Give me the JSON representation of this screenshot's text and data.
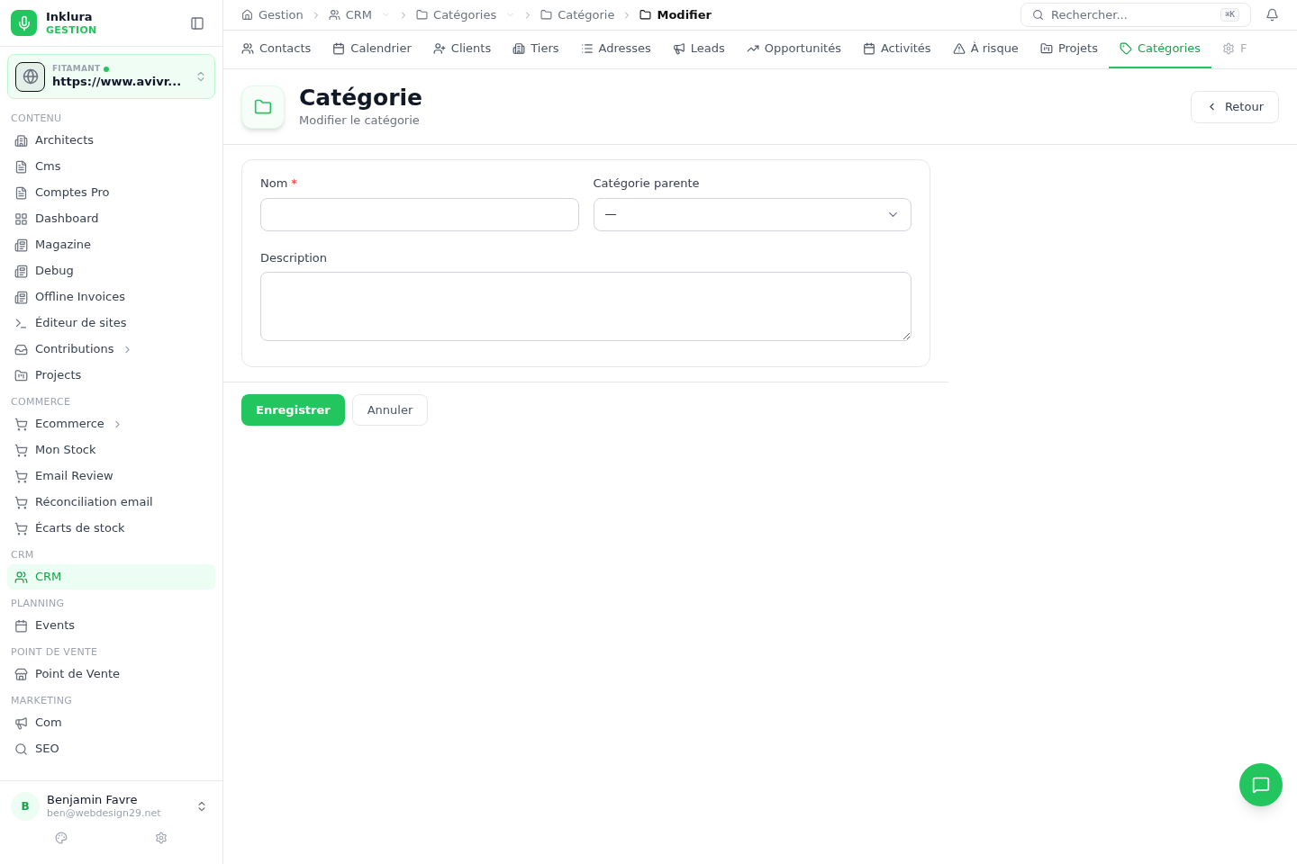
{
  "brand": {
    "name": "Inklura",
    "subtitle": "GESTION"
  },
  "workspace": {
    "label": "FITAMANT",
    "online": true,
    "url": "https://www.avivr..."
  },
  "sidebar": {
    "sections": [
      {
        "title": "CONTENU",
        "items": [
          {
            "label": "Architects",
            "selected": false,
            "has_children": false
          },
          {
            "label": "Cms",
            "selected": false,
            "has_children": false
          },
          {
            "label": "Comptes Pro",
            "selected": false,
            "has_children": false
          },
          {
            "label": "Dashboard",
            "selected": false,
            "has_children": false
          },
          {
            "label": "Magazine",
            "selected": false,
            "has_children": false
          },
          {
            "label": "Debug",
            "selected": false,
            "has_children": false
          },
          {
            "label": "Offline Invoices",
            "selected": false,
            "has_children": false
          },
          {
            "label": "Éditeur de sites",
            "selected": false,
            "has_children": false
          },
          {
            "label": "Contributions",
            "selected": false,
            "has_children": true
          },
          {
            "label": "Projects",
            "selected": false,
            "has_children": false
          }
        ]
      },
      {
        "title": "COMMERCE",
        "items": [
          {
            "label": "Ecommerce",
            "selected": false,
            "has_children": true
          },
          {
            "label": "Mon Stock",
            "selected": false,
            "has_children": false
          },
          {
            "label": "Email Review",
            "selected": false,
            "has_children": false
          },
          {
            "label": "Réconciliation email",
            "selected": false,
            "has_children": false
          },
          {
            "label": "Écarts de stock",
            "selected": false,
            "has_children": false
          }
        ]
      },
      {
        "title": "CRM",
        "items": [
          {
            "label": "CRM",
            "selected": true,
            "has_children": false
          }
        ]
      },
      {
        "title": "PLANNING",
        "items": [
          {
            "label": "Events",
            "selected": false,
            "has_children": false
          }
        ]
      },
      {
        "title": "POINT DE VENTE",
        "items": [
          {
            "label": "Point de Vente",
            "selected": false,
            "has_children": false
          }
        ]
      },
      {
        "title": "MARKETING",
        "items": [
          {
            "label": "Com",
            "selected": false,
            "has_children": false
          },
          {
            "label": "SEO",
            "selected": false,
            "has_children": false
          }
        ]
      }
    ]
  },
  "user": {
    "initial": "B",
    "name": "Benjamin Favre",
    "email": "ben@webdesign29.net"
  },
  "breadcrumbs": [
    {
      "label": "Gestion",
      "dropdown": false,
      "current": false
    },
    {
      "label": "CRM",
      "dropdown": true,
      "current": false
    },
    {
      "label": "Catégories",
      "dropdown": true,
      "current": false
    },
    {
      "label": "Catégorie",
      "dropdown": false,
      "current": false
    },
    {
      "label": "Modifier",
      "dropdown": false,
      "current": true
    }
  ],
  "search": {
    "placeholder": "Rechercher...",
    "shortcut": "⌘K"
  },
  "tabs": [
    {
      "label": "Contacts",
      "selected": false,
      "faded": false
    },
    {
      "label": "Calendrier",
      "selected": false,
      "faded": false
    },
    {
      "label": "Clients",
      "selected": false,
      "faded": false
    },
    {
      "label": "Tiers",
      "selected": false,
      "faded": false
    },
    {
      "label": "Adresses",
      "selected": false,
      "faded": false
    },
    {
      "label": "Leads",
      "selected": false,
      "faded": false
    },
    {
      "label": "Opportunités",
      "selected": false,
      "faded": false
    },
    {
      "label": "Activités",
      "selected": false,
      "faded": false
    },
    {
      "label": "À risque",
      "selected": false,
      "faded": false
    },
    {
      "label": "Projets",
      "selected": false,
      "faded": false
    },
    {
      "label": "Catégories",
      "selected": true,
      "faded": false
    },
    {
      "label": "F",
      "selected": false,
      "faded": true
    }
  ],
  "page": {
    "title": "Catégorie",
    "subtitle": "Modifier le catégorie",
    "back": "Retour"
  },
  "form": {
    "required_mark": "*",
    "fields": [
      {
        "kind": "text",
        "label": "Nom",
        "required": true
      },
      {
        "kind": "select",
        "label": "Catégorie parente",
        "required": false,
        "value": "—"
      },
      {
        "kind": "textarea",
        "label": "Description",
        "required": false
      }
    ]
  },
  "actions": [
    {
      "label": "Enregistrer",
      "primary": true
    },
    {
      "label": "Annuler",
      "primary": false
    }
  ]
}
